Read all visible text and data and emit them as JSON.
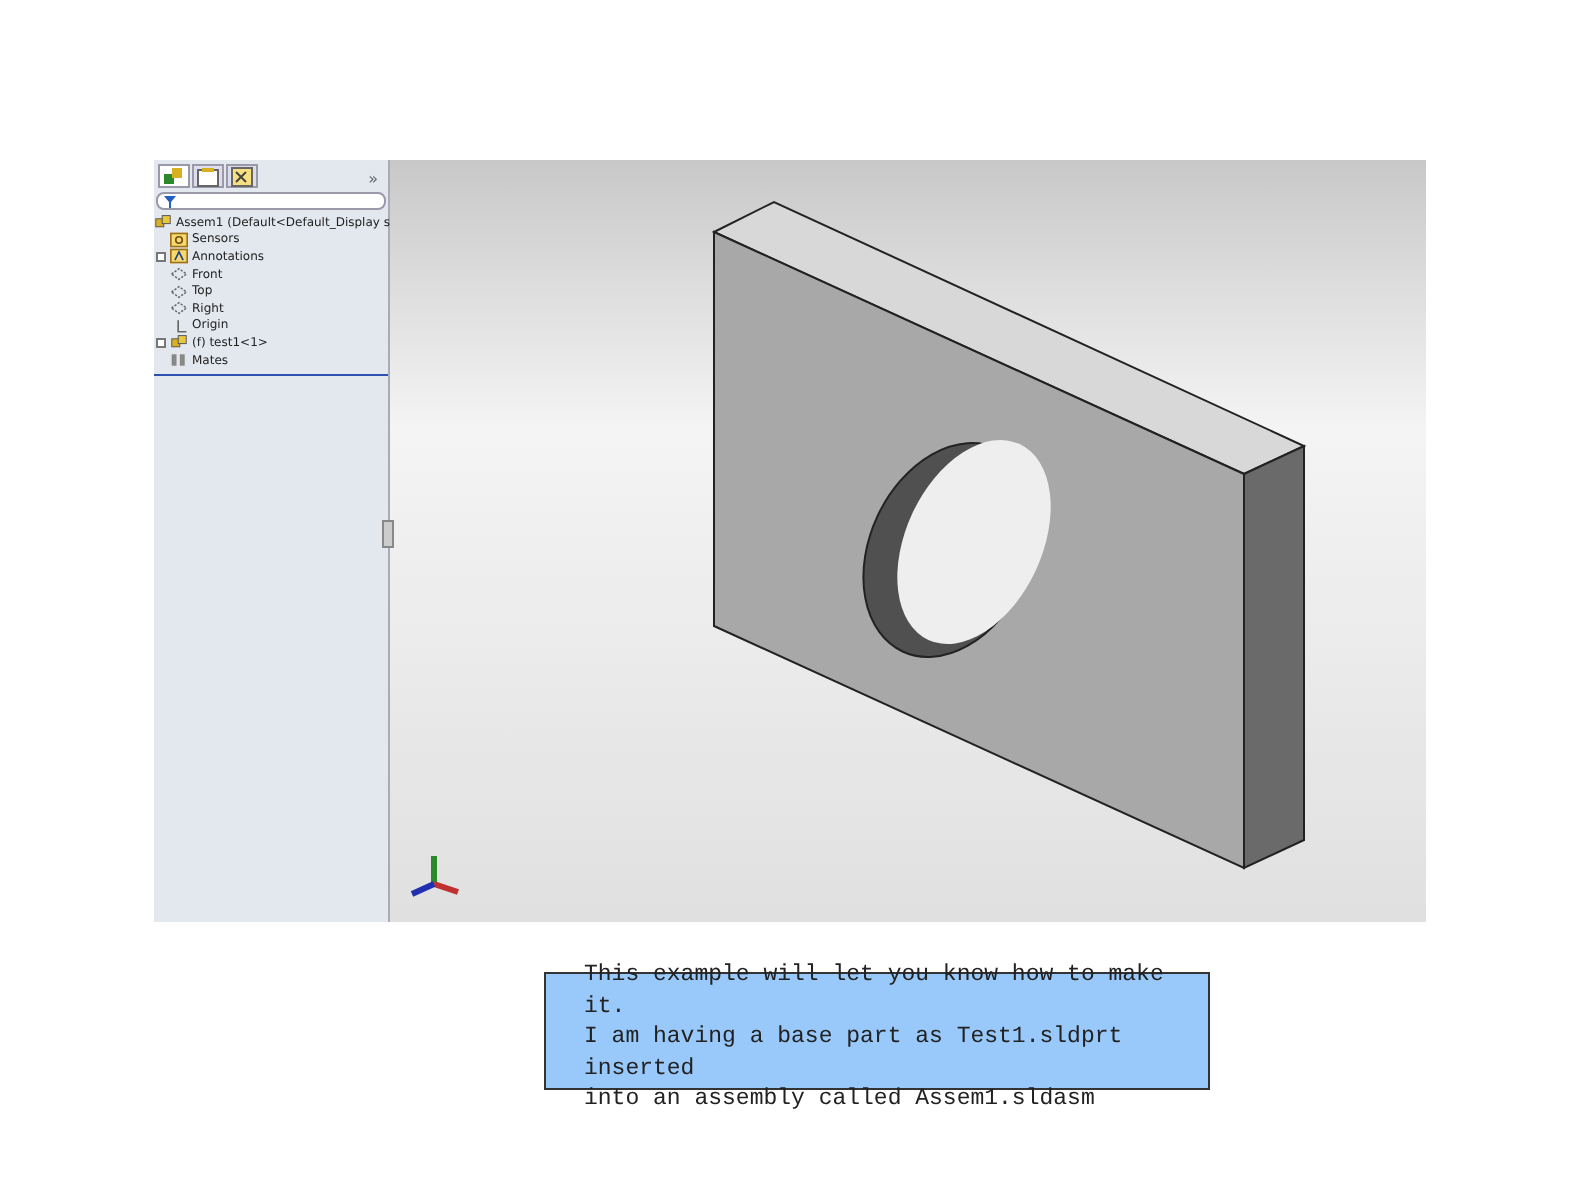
{
  "feature_manager": {
    "tabs": [
      {
        "kind": "tree",
        "selected": true
      },
      {
        "kind": "properties",
        "selected": false
      },
      {
        "kind": "config",
        "selected": false
      }
    ],
    "overflow": "»",
    "tree": {
      "label": "Assem1  (Default<Default_Display s",
      "kind": "assembly",
      "children": [
        {
          "label": "Sensors",
          "kind": "folder"
        },
        {
          "label": "Annotations",
          "kind": "annotation",
          "expanded": false
        },
        {
          "label": "Front",
          "kind": "plane"
        },
        {
          "label": "Top",
          "kind": "plane"
        },
        {
          "label": "Right",
          "kind": "plane"
        },
        {
          "label": "Origin",
          "kind": "origin"
        },
        {
          "label": "(f) test1<1>",
          "kind": "part",
          "expanded": false
        },
        {
          "label": "Mates",
          "kind": "mates"
        }
      ]
    }
  },
  "caption": {
    "lines": [
      "This example will let you know how to make",
      "it.",
      "I am having a base part as Test1.sldprt",
      "inserted",
      "into an assembly called Assem1.sldasm"
    ]
  }
}
